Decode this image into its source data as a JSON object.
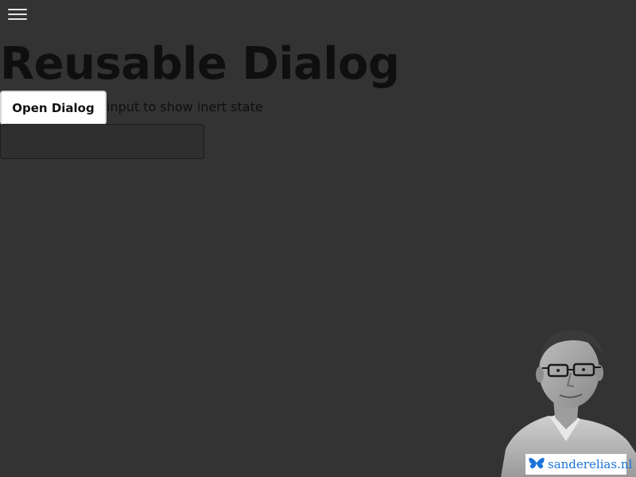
{
  "page": {
    "title": "Reusable Dialog",
    "hint": "input to show inert state"
  },
  "nav": {
    "menu_icon": "hamburger-menu-icon"
  },
  "actions": {
    "open_dialog_label": "Open Dialog"
  },
  "input": {
    "value": "",
    "placeholder": ""
  },
  "branding": {
    "site_label": "sanderelias.nl",
    "icon": "butterfly-icon",
    "link_color": "#1a73d9"
  },
  "colors": {
    "background": "#333333",
    "text": "#0f0f0f",
    "button_bg": "#ffffff"
  }
}
